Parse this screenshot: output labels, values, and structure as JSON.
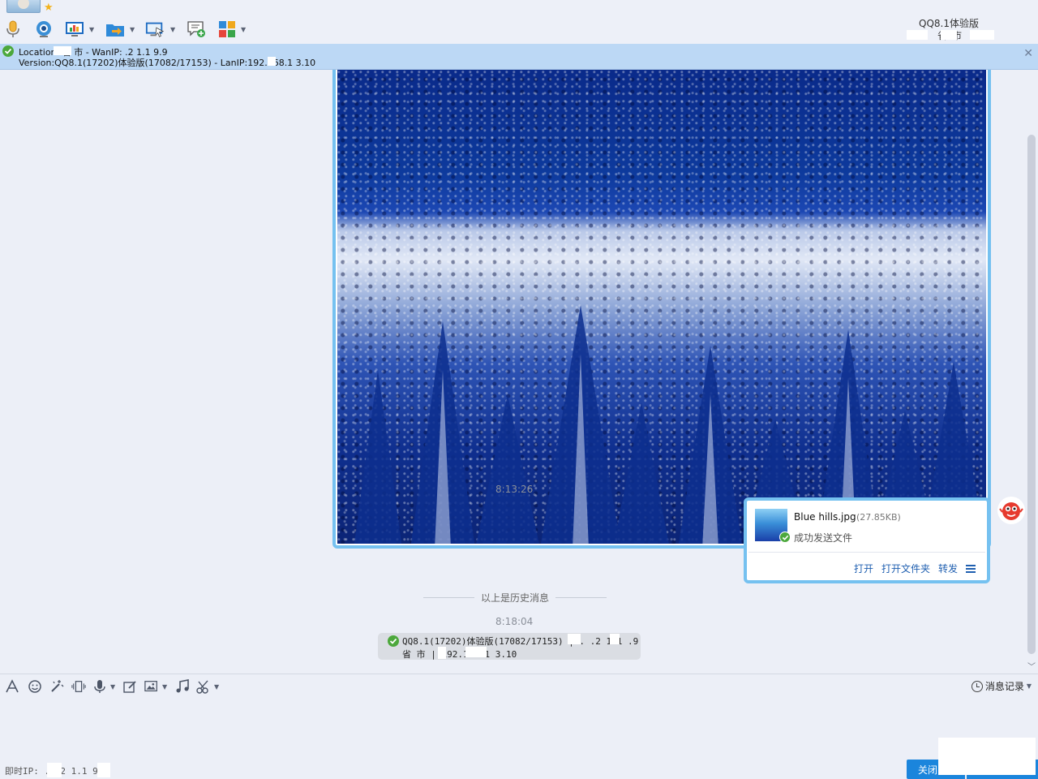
{
  "header": {
    "client_title": "QQ8.1体验版",
    "client_location": "省市"
  },
  "toolbar": {
    "icons": [
      "microphone-icon",
      "video-camera-icon",
      "remote-desktop-icon",
      "send-file-icon",
      "screen-share-icon",
      "new-discussion-icon",
      "apps-icon"
    ]
  },
  "infobar": {
    "location_text": "Location:    省    市    - WanIP:   .2   1.1   9.9",
    "version_text": "Version:QQ8.1(17202)体验版(17082/17153) - LanIP:192.168.1   3.10"
  },
  "chat": {
    "photo_time": "8:13:26",
    "file": {
      "name": "Blue hills.jpg",
      "size": "(27.85KB)",
      "status": "成功发送文件",
      "actions": [
        "打开",
        "打开文件夹",
        "转发"
      ]
    },
    "history_separator": "以上是历史消息",
    "system_time": "8:18:04",
    "system_line1": "QQ8.1(17202)体验版(17082/17153) | . .2 1.1  .9",
    "system_line2": "  省   市      | 192.168.1  3.10"
  },
  "input_toolbar": {
    "history_label": "消息记录"
  },
  "footer": {
    "ip_label": "即时IP: . .2 1.1 9.9",
    "close_label": "关闭"
  },
  "colors": {
    "accent": "#1b85dc",
    "bubble_border": "#75c1f0",
    "infobar_bg": "#bcd8f5",
    "success_green": "#4ca83c"
  }
}
